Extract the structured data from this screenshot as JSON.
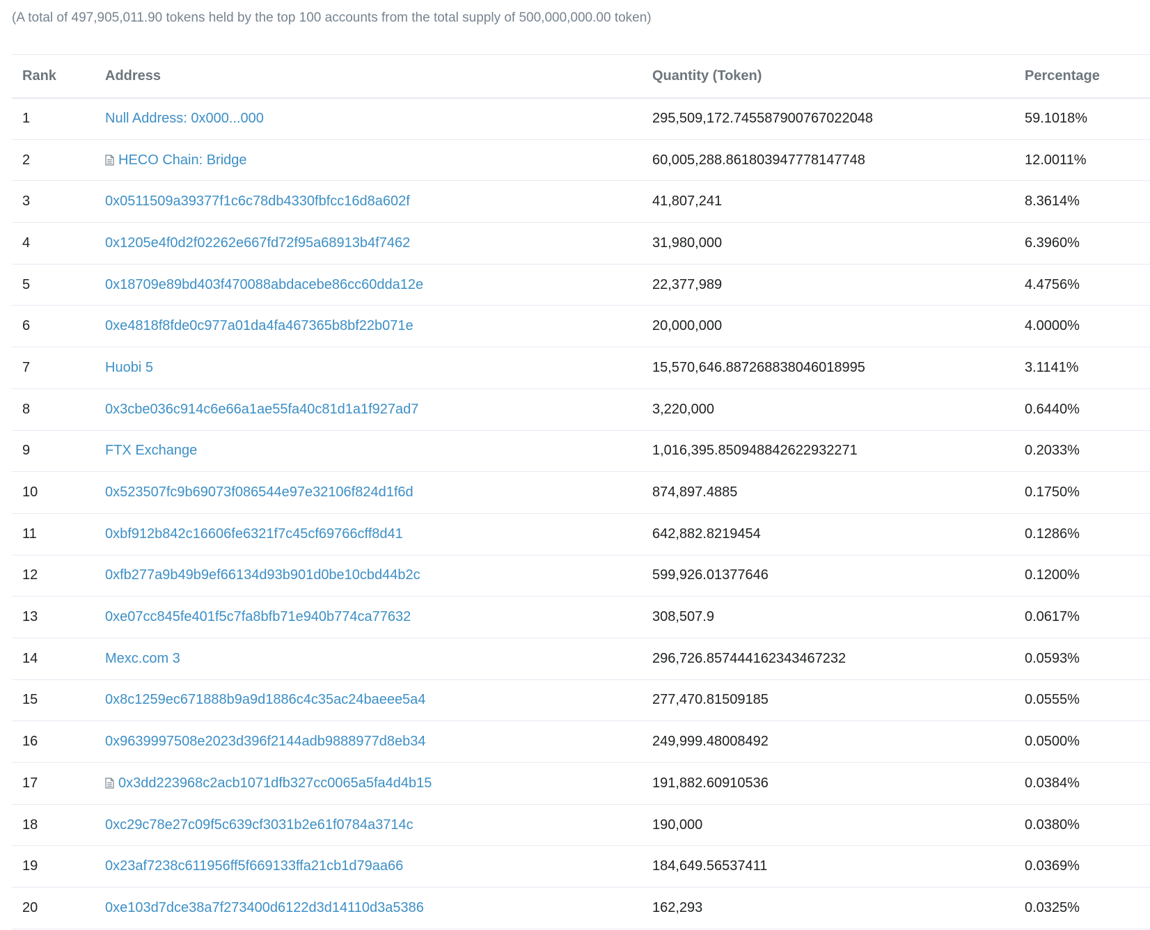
{
  "summary": "(A total of 497,905,011.90 tokens held by the top 100 accounts from the total supply of 500,000,000.00 token)",
  "table": {
    "headers": {
      "rank": "Rank",
      "address": "Address",
      "quantity": "Quantity (Token)",
      "percentage": "Percentage"
    },
    "rows": [
      {
        "rank": "1",
        "address": "Null Address: 0x000...000",
        "contract": false,
        "quantity": "295,509,172.745587900767022048",
        "percentage": "59.1018%"
      },
      {
        "rank": "2",
        "address": "HECO Chain: Bridge",
        "contract": true,
        "quantity": "60,005,288.861803947778147748",
        "percentage": "12.0011%"
      },
      {
        "rank": "3",
        "address": "0x0511509a39377f1c6c78db4330fbfcc16d8a602f",
        "contract": false,
        "quantity": "41,807,241",
        "percentage": "8.3614%"
      },
      {
        "rank": "4",
        "address": "0x1205e4f0d2f02262e667fd72f95a68913b4f7462",
        "contract": false,
        "quantity": "31,980,000",
        "percentage": "6.3960%"
      },
      {
        "rank": "5",
        "address": "0x18709e89bd403f470088abdacebe86cc60dda12e",
        "contract": false,
        "quantity": "22,377,989",
        "percentage": "4.4756%"
      },
      {
        "rank": "6",
        "address": "0xe4818f8fde0c977a01da4fa467365b8bf22b071e",
        "contract": false,
        "quantity": "20,000,000",
        "percentage": "4.0000%"
      },
      {
        "rank": "7",
        "address": "Huobi 5",
        "contract": false,
        "quantity": "15,570,646.887268838046018995",
        "percentage": "3.1141%"
      },
      {
        "rank": "8",
        "address": "0x3cbe036c914c6e66a1ae55fa40c81d1a1f927ad7",
        "contract": false,
        "quantity": "3,220,000",
        "percentage": "0.6440%"
      },
      {
        "rank": "9",
        "address": "FTX Exchange",
        "contract": false,
        "quantity": "1,016,395.850948842622932271",
        "percentage": "0.2033%"
      },
      {
        "rank": "10",
        "address": "0x523507fc9b69073f086544e97e32106f824d1f6d",
        "contract": false,
        "quantity": "874,897.4885",
        "percentage": "0.1750%"
      },
      {
        "rank": "11",
        "address": "0xbf912b842c16606fe6321f7c45cf69766cff8d41",
        "contract": false,
        "quantity": "642,882.8219454",
        "percentage": "0.1286%"
      },
      {
        "rank": "12",
        "address": "0xfb277a9b49b9ef66134d93b901d0be10cbd44b2c",
        "contract": false,
        "quantity": "599,926.01377646",
        "percentage": "0.1200%"
      },
      {
        "rank": "13",
        "address": "0xe07cc845fe401f5c7fa8bfb71e940b774ca77632",
        "contract": false,
        "quantity": "308,507.9",
        "percentage": "0.0617%"
      },
      {
        "rank": "14",
        "address": "Mexc.com 3",
        "contract": false,
        "quantity": "296,726.857444162343467232",
        "percentage": "0.0593%"
      },
      {
        "rank": "15",
        "address": "0x8c1259ec671888b9a9d1886c4c35ac24baeee5a4",
        "contract": false,
        "quantity": "277,470.81509185",
        "percentage": "0.0555%"
      },
      {
        "rank": "16",
        "address": "0x9639997508e2023d396f2144adb9888977d8eb34",
        "contract": false,
        "quantity": "249,999.48008492",
        "percentage": "0.0500%"
      },
      {
        "rank": "17",
        "address": "0x3dd223968c2acb1071dfb327cc0065a5fa4d4b15",
        "contract": true,
        "quantity": "191,882.60910536",
        "percentage": "0.0384%"
      },
      {
        "rank": "18",
        "address": "0xc29c78e27c09f5c639cf3031b2e61f0784a3714c",
        "contract": false,
        "quantity": "190,000",
        "percentage": "0.0380%"
      },
      {
        "rank": "19",
        "address": "0x23af7238c611956ff5f669133ffa21cb1d79aa66",
        "contract": false,
        "quantity": "184,649.56537411",
        "percentage": "0.0369%"
      },
      {
        "rank": "20",
        "address": "0xe103d7dce38a7f273400d6122d3d14110d3a5386",
        "contract": false,
        "quantity": "162,293",
        "percentage": "0.0325%"
      }
    ]
  },
  "colors": {
    "link": "#3d8fc6",
    "text": "#1e2022",
    "muted": "#77838f",
    "border": "#e7eaf3"
  },
  "icons": {
    "contract": "contract-file-icon"
  }
}
